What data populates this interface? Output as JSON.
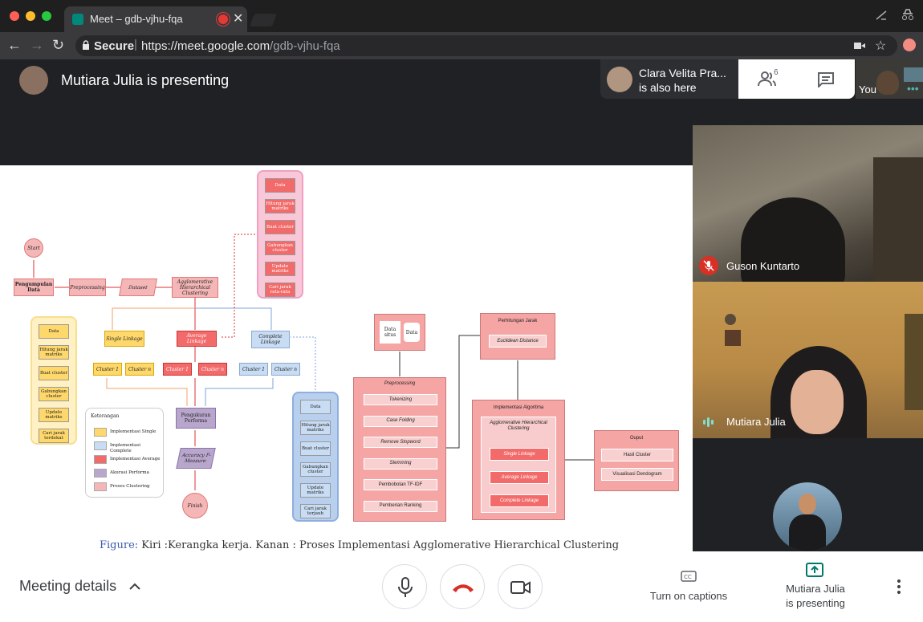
{
  "browser": {
    "tab_title": "Meet – gdb-vjhu-fqa",
    "secure_label": "Secure",
    "url_host": "https://meet.google.com",
    "url_path": "/gdb-vjhu-fqa"
  },
  "meet": {
    "presenting_title": "Mutiara Julia is presenting",
    "also_here_name": "Clara Velita Pra...",
    "also_here_text": "is also here",
    "participant_count": "6",
    "self_label": "You"
  },
  "slide": {
    "caption_prefix": "Figure:",
    "caption": " Kiri :Kerangka kerja. Kanan : Proses Implementasi Agglomerative Hierarchical Clustering",
    "left": {
      "start": "Start",
      "pengumpulan": "Pengumpulan Data",
      "preprocessing": "Preprocessing",
      "dataset": "Dataset",
      "ahc": "Agglomerative Hierarchical Clustering",
      "single": "Single Linkage",
      "average": "Average Linkage",
      "complete": "Complete Linkage",
      "cluster1": "Cluster 1",
      "clustern": "Cluster n",
      "pengukuran": "Pengukuran Performa",
      "accuracy": "Accuracy F-Measure",
      "finish": "Finish",
      "keterangan": "Keterangan",
      "legend": [
        "Implementasi Single",
        "Implementasi Complete",
        "Implementasi Average",
        "Akurasi Performa",
        "Proses Clustering"
      ],
      "steps": [
        "Data",
        "Hitung jarak matriks",
        "Buat cluster",
        "Gabungkan cluster",
        "Update matriks",
        "Cari jarak terdekat"
      ],
      "steps_pink": [
        "Data",
        "Hitung jarak matriks",
        "Buat cluster",
        "Gabungkan cluster",
        "Update matriks",
        "Cari jarak rata-rata"
      ],
      "steps_blue": [
        "Data",
        "Hitung jarak matriks",
        "Buat cluster",
        "Gabungkan cluster",
        "Update matriks",
        "Cari jarak terjauh"
      ]
    },
    "right": {
      "data_sites": "Data situs",
      "data": "Data",
      "preprocessing": "Preprocessing",
      "pre_steps": [
        "Tokenizing",
        "Case Folding",
        "Remove Stopword",
        "Stemming",
        "Pembobotan TF-IDF",
        "Pemberian Ranking"
      ],
      "perhitungan": "Perhitungan Jarak",
      "euclidean": "Euclidean Distance",
      "implementasi": "Implementasi Algoritma",
      "ahc": "Agglomerative Hierarchical Clustering",
      "algos": [
        "Single Linkage",
        "Average Linkage",
        "Complete Linkage"
      ],
      "ouput": "Ouput",
      "hasil": "Hasil Cluster",
      "visualisasi": "Visualisasi Dendogram"
    }
  },
  "tiles": [
    {
      "name": "Guson Kuntarto"
    },
    {
      "name": "Mutiara Julia"
    }
  ],
  "bottom": {
    "meeting_details": "Meeting details",
    "captions": "Turn on captions",
    "presenting_line1": "Mutiara Julia",
    "presenting_line2": "is presenting"
  },
  "colors": {
    "end_call": "#d93025",
    "accent": "#00796b",
    "mic_off": "#d93025"
  }
}
